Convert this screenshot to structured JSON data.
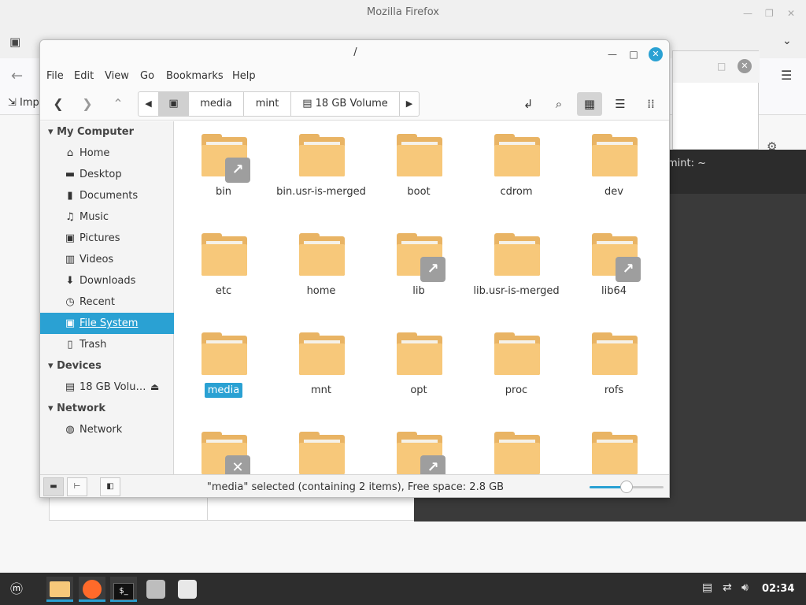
{
  "firefox": {
    "title": "Mozilla Firefox",
    "bookmark_label": "Imp"
  },
  "terminal": {
    "title": "mint: ~"
  },
  "nemo": {
    "title": "/",
    "menu": [
      "File",
      "Edit",
      "View",
      "Go",
      "Bookmarks",
      "Help"
    ],
    "path": [
      "media",
      "mint",
      "18 GB Volume"
    ],
    "sidebar": {
      "my_computer_header": "My Computer",
      "items": [
        {
          "label": "Home",
          "icon": "home-icon"
        },
        {
          "label": "Desktop",
          "icon": "desktop-icon"
        },
        {
          "label": "Documents",
          "icon": "documents-icon"
        },
        {
          "label": "Music",
          "icon": "music-icon"
        },
        {
          "label": "Pictures",
          "icon": "pictures-icon"
        },
        {
          "label": "Videos",
          "icon": "videos-icon"
        },
        {
          "label": "Downloads",
          "icon": "downloads-icon"
        },
        {
          "label": "Recent",
          "icon": "recent-icon"
        },
        {
          "label": "File System",
          "icon": "file-system-icon"
        },
        {
          "label": "Trash",
          "icon": "trash-icon"
        }
      ],
      "devices_header": "Devices",
      "device": "18 GB Volu…",
      "network_header": "Network",
      "network_item": "Network"
    },
    "files": [
      {
        "name": "bin",
        "badge": "link"
      },
      {
        "name": "bin.usr-is-merged",
        "badge": ""
      },
      {
        "name": "boot",
        "badge": ""
      },
      {
        "name": "cdrom",
        "badge": ""
      },
      {
        "name": "dev",
        "badge": ""
      },
      {
        "name": "etc",
        "badge": ""
      },
      {
        "name": "home",
        "badge": ""
      },
      {
        "name": "lib",
        "badge": "link"
      },
      {
        "name": "lib.usr-is-merged",
        "badge": ""
      },
      {
        "name": "lib64",
        "badge": "link"
      },
      {
        "name": "media",
        "badge": "",
        "selected": true
      },
      {
        "name": "mnt",
        "badge": ""
      },
      {
        "name": "opt",
        "badge": ""
      },
      {
        "name": "proc",
        "badge": ""
      },
      {
        "name": "rofs",
        "badge": ""
      },
      {
        "name": "",
        "badge": "broken"
      },
      {
        "name": "",
        "badge": ""
      },
      {
        "name": "",
        "badge": "link"
      },
      {
        "name": "",
        "badge": ""
      },
      {
        "name": "",
        "badge": ""
      }
    ],
    "status": "\"media\" selected (containing 2 items), Free space: 2.8 GB",
    "zoom_level": 0.5
  },
  "taskbar": {
    "clock": "02:34",
    "apps": [
      "files",
      "firefox",
      "terminal",
      "disks",
      "software"
    ]
  },
  "colors": {
    "accent": "#2aa1d3",
    "folder": "#f7c87a",
    "taskbar": "#2d2d2d"
  }
}
